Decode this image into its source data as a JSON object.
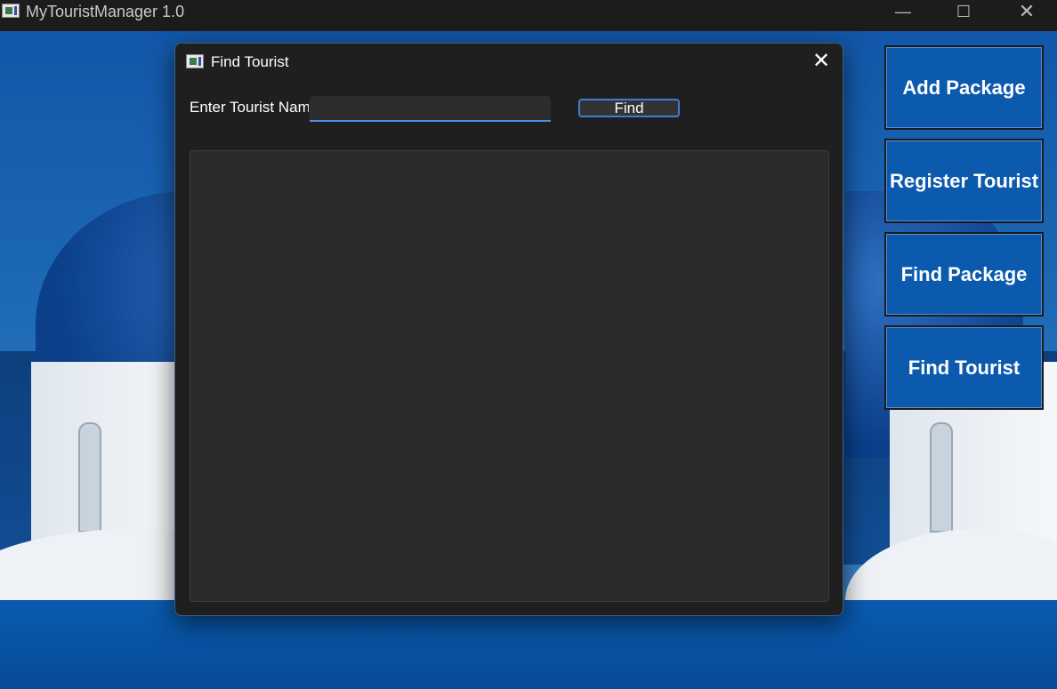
{
  "window": {
    "title": "MyTouristManager 1.0",
    "controls": {
      "minimize": "—",
      "maximize": "☐",
      "close": "✕"
    }
  },
  "sidebar": {
    "buttons": [
      {
        "label": "Add Package"
      },
      {
        "label": "Register Tourist"
      },
      {
        "label": "Find Package"
      },
      {
        "label": "Find Tourist"
      }
    ]
  },
  "dialog": {
    "title": "Find Tourist",
    "close_glyph": "✕",
    "name_label": "Enter Tourist Nam",
    "name_value": "",
    "find_label": "Find"
  },
  "colors": {
    "accent": "#4a90e2",
    "sidebar_button": "#0b5aad",
    "dialog_bg": "#1f1f1f"
  }
}
